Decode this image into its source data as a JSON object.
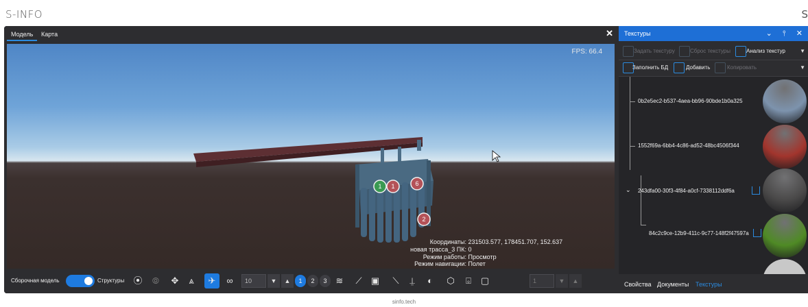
{
  "brand": {
    "left": "S-INFO",
    "right": "S"
  },
  "footer": "sinfo.tech",
  "main": {
    "tabs": [
      {
        "label": "Модель"
      },
      {
        "label": "Карта"
      }
    ],
    "close": "✕",
    "fps": "FPS: 66.4",
    "markers": [
      "1",
      "1",
      "6",
      "2"
    ],
    "info": {
      "coords_label": "Координаты:",
      "coords_value": "231503.577, 178451.707, 152.637",
      "route_label": "новая трасса_3 ПК:",
      "route_value": "0",
      "mode_label": "Режим работы:",
      "mode_value": "Просмотр",
      "nav_label": "Режим навигации:",
      "nav_value": "Полет"
    },
    "bottombar": {
      "assembly_label": "Сборочная модель",
      "structures_label": "Структуры",
      "count_value": "10",
      "pages": [
        "1",
        "2",
        "3"
      ],
      "right_value": "1"
    }
  },
  "panel": {
    "title": "Текстуры",
    "title_icons": "⌄ ⫯ ✕",
    "toolbar1": {
      "set_texture": "Задать текстуру",
      "reset_textures": "Сброс текстуры",
      "analyze_textures": "Анализ текстур"
    },
    "toolbar2": {
      "fill_db": "Заполнить БД",
      "add": "Добавить",
      "copy": "Копировать"
    },
    "tree": [
      {
        "label": "0b2e5ec2-b537-4aea-bb96-90bde1b0a325",
        "color": "#7d93ad"
      },
      {
        "label": "1552f69a-6bb4-4c86-ad52-48bc4506f344",
        "color": "#a2352d"
      },
      {
        "label": "243dfa00-30f3-4f84-a0cf-7338112ddf6a",
        "color": "#4a4949"
      },
      {
        "label": "84c2c9ce-12b9-411c-9c77-148f2f47597a",
        "color": "#4f8a25"
      }
    ],
    "tabs": [
      {
        "label": "Свойства"
      },
      {
        "label": "Документы"
      },
      {
        "label": "Текстуры"
      }
    ]
  }
}
